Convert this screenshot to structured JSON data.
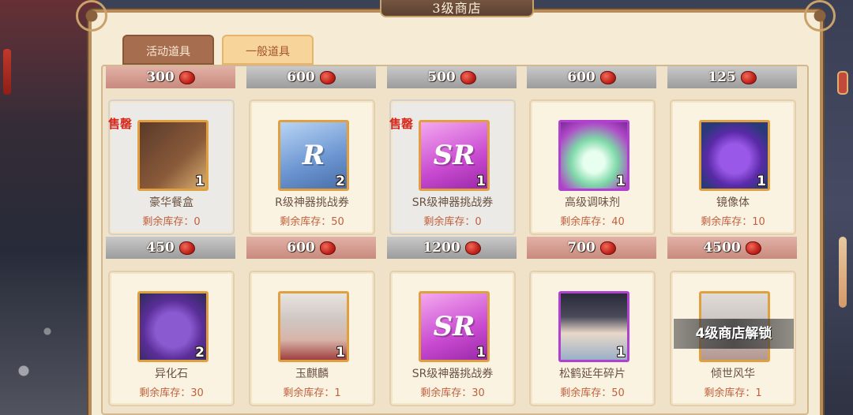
{
  "window": {
    "title": "3级商店"
  },
  "tabs": [
    {
      "label": "活动道具",
      "active": false
    },
    {
      "label": "一般道具",
      "active": true
    }
  ],
  "top_prices": [
    "300",
    "600",
    "500",
    "600",
    "125"
  ],
  "row1": [
    {
      "price": "450",
      "name": "豪华餐盒",
      "stock": "剩余库存：0",
      "qty": "1",
      "soldout": "售罄",
      "icon": "lunchbox-icon"
    },
    {
      "price": "600",
      "name": "R级神器挑战券",
      "stock": "剩余库存：50",
      "qty": "2",
      "glyph": "R",
      "icon": "r-ticket-icon"
    },
    {
      "price": "1200",
      "name": "SR级神器挑战券",
      "stock": "剩余库存：0",
      "qty": "1",
      "soldout": "售罄",
      "glyph": "SR",
      "icon": "sr-ticket-icon"
    },
    {
      "price": "700",
      "name": "高级调味剂",
      "stock": "剩余库存：40",
      "qty": "1",
      "icon": "seasoning-icon"
    },
    {
      "price": "4500",
      "name": "镜像体",
      "stock": "剩余库存：10",
      "qty": "1",
      "icon": "mirror-slime-icon"
    }
  ],
  "row2": [
    {
      "name": "异化石",
      "stock": "剩余库存：30",
      "qty": "2",
      "icon": "mutation-stone-icon"
    },
    {
      "name": "玉麒麟",
      "stock": "剩余库存：1",
      "qty": "1",
      "icon": "character-portrait-icon"
    },
    {
      "name": "SR级神器挑战券",
      "stock": "剩余库存：30",
      "qty": "1",
      "glyph": "SR",
      "icon": "sr-ticket-icon"
    },
    {
      "name": "松鹤延年碎片",
      "stock": "剩余库存：50",
      "qty": "1",
      "icon": "character-shard-icon"
    },
    {
      "name": "倾世风华",
      "stock": "剩余库存：1",
      "qty": "",
      "icon": "character-portrait-icon"
    }
  ],
  "lock_text": "4级商店解锁",
  "colors": {
    "accent": "#e0a040",
    "soldout": "#d8281c",
    "stock": "#c0603c"
  }
}
